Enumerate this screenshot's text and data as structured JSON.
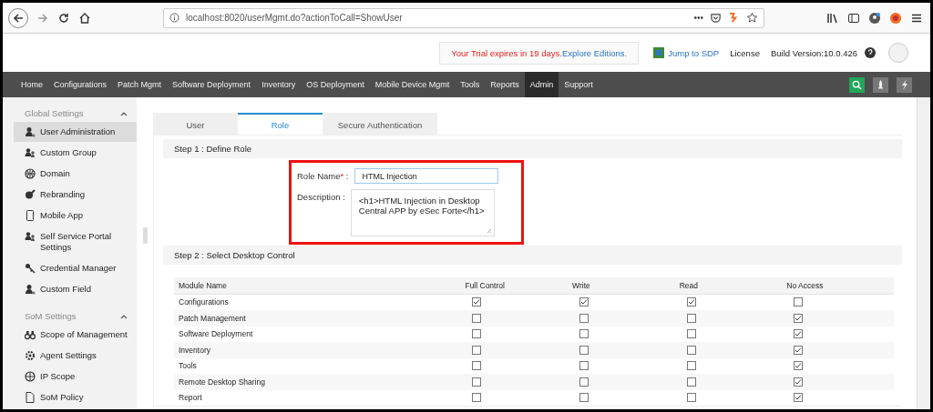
{
  "browser": {
    "url": "localhost:8020/userMgmt.do?actionToCall=ShowUser",
    "menu_dots": "•••"
  },
  "header": {
    "trial_text": "Your Trial expires in 19 days.",
    "trial_link": "Explore Editions.",
    "jump_link": "Jump to SDP",
    "license": "License",
    "build": "Build Version:10.0.426"
  },
  "nav": {
    "items": [
      {
        "label": "Home",
        "selected": false
      },
      {
        "label": "Configurations",
        "selected": false
      },
      {
        "label": "Patch Mgmt",
        "selected": false
      },
      {
        "label": "Software Deployment",
        "selected": false
      },
      {
        "label": "Inventory",
        "selected": false
      },
      {
        "label": "OS Deployment",
        "selected": false
      },
      {
        "label": "Mobile Device Mgmt",
        "selected": false
      },
      {
        "label": "Tools",
        "selected": false
      },
      {
        "label": "Reports",
        "selected": false
      },
      {
        "label": "Admin",
        "selected": true
      },
      {
        "label": "Support",
        "selected": false
      }
    ]
  },
  "sidebar": {
    "sections": [
      {
        "title": "Global Settings",
        "expanded": true,
        "items": [
          {
            "label": "User Administration",
            "selected": true
          },
          {
            "label": "Custom Group",
            "selected": false
          },
          {
            "label": "Domain",
            "selected": false
          },
          {
            "label": "Rebranding",
            "selected": false
          },
          {
            "label": "Mobile App",
            "selected": false
          },
          {
            "label": "Self Service Portal Settings",
            "selected": false
          },
          {
            "label": "Credential Manager",
            "selected": false
          },
          {
            "label": "Custom Field",
            "selected": false
          }
        ]
      },
      {
        "title": "SoM Settings",
        "expanded": true,
        "items": [
          {
            "label": "Scope of Management",
            "selected": false
          },
          {
            "label": "Agent Settings",
            "selected": false
          },
          {
            "label": "IP Scope",
            "selected": false
          },
          {
            "label": "SoM Policy",
            "selected": false
          }
        ]
      }
    ]
  },
  "tabs": [
    {
      "label": "User",
      "selected": false
    },
    {
      "label": "Role",
      "selected": true
    },
    {
      "label": "Secure Authentication",
      "selected": false
    }
  ],
  "step1": {
    "title": "Step 1 : Define Role",
    "role_label": "Role Name",
    "required_mark": "*",
    "role_colon": ":",
    "role_value": "HTML Injection",
    "desc_label": "Description :",
    "desc_value": "<h1>HTML Injection in Desktop Central APP by eSec Forte</h1>"
  },
  "step2": {
    "title": "Step 2 : Select Desktop Control",
    "columns": [
      "Module Name",
      "Full Control",
      "Write",
      "Read",
      "No Access"
    ],
    "rows": [
      {
        "name": "Configurations",
        "checks": [
          true,
          true,
          true,
          false
        ]
      },
      {
        "name": "Patch Management",
        "checks": [
          false,
          false,
          false,
          true
        ]
      },
      {
        "name": "Software Deployment",
        "checks": [
          false,
          false,
          false,
          true
        ]
      },
      {
        "name": "Inventory",
        "checks": [
          false,
          false,
          false,
          true
        ]
      },
      {
        "name": "Tools",
        "checks": [
          false,
          false,
          false,
          true
        ]
      },
      {
        "name": "Remote Desktop Sharing",
        "checks": [
          false,
          false,
          false,
          true
        ]
      },
      {
        "name": "Report",
        "checks": [
          false,
          false,
          false,
          true
        ]
      }
    ]
  }
}
